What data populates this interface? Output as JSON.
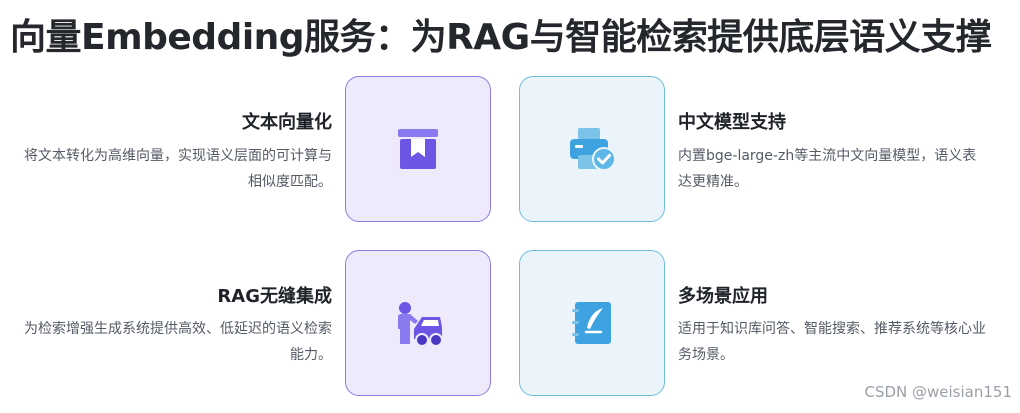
{
  "title": "向量Embedding服务：为RAG与智能检索提供底层语义支撑",
  "features": [
    {
      "title": "文本向量化",
      "desc": "将文本转化为高维向量，实现语义层面的可计算与相似度匹配。",
      "icon": "box-icon"
    },
    {
      "title": "中文模型支持",
      "desc": "内置bge-large-zh等主流中文向量模型，语义表达更精准。",
      "icon": "printer-check-icon"
    },
    {
      "title": "RAG无缝集成",
      "desc": "为检索增强生成系统提供高效、低延迟的语义检索能力。",
      "icon": "mechanic-car-icon"
    },
    {
      "title": "多场景应用",
      "desc": "适用于知识库问答、智能搜索、推荐系统等核心业务场景。",
      "icon": "notebook-quill-icon"
    }
  ],
  "watermark": "CSDN @weisian151",
  "colors": {
    "purple_border": "#8f7de0",
    "purple_bg": "#eeeafb",
    "purple_icon": "#6b56e6",
    "blue_border": "#6fbfdc",
    "blue_bg": "#ecf4fb",
    "blue_icon": "#3ea2e0"
  }
}
